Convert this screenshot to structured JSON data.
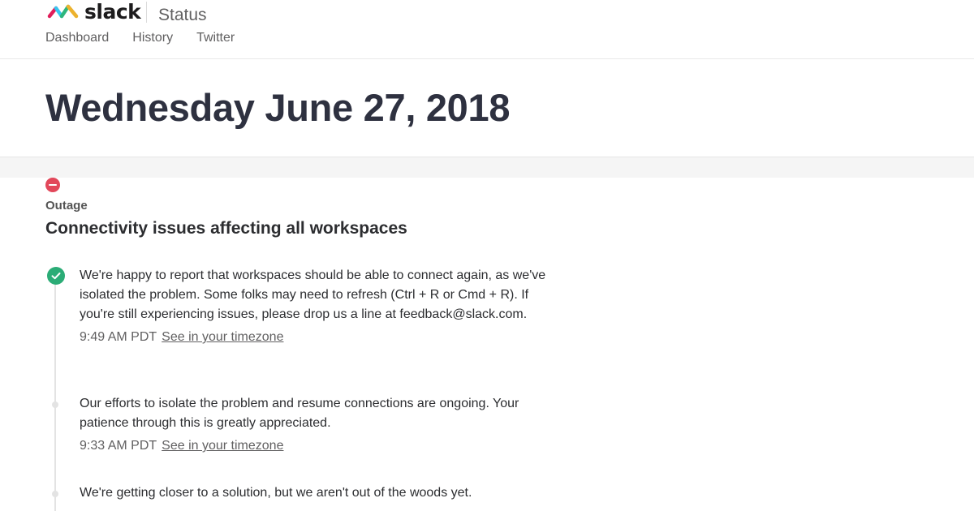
{
  "header": {
    "brand_name": "slack",
    "section_title": "Status",
    "nav": [
      {
        "label": "Dashboard"
      },
      {
        "label": "History"
      },
      {
        "label": "Twitter"
      }
    ]
  },
  "date_title": "Wednesday June 27, 2018",
  "incident": {
    "status_icon": "minus-circle-icon",
    "status_color": "#e2475a",
    "type": "Outage",
    "title": "Connectivity issues affecting all workspaces"
  },
  "updates": [
    {
      "icon": "check-circle-icon",
      "icon_color": "#2bac76",
      "text": "We're happy to report that workspaces should be able to connect again, as we've isolated the problem. Some folks may need to refresh (Ctrl + R or Cmd + R). If you're still experiencing issues, please drop us a line at feedback@slack.com.",
      "time": "9:49 AM PDT",
      "tz_link": "See in your timezone"
    },
    {
      "icon": "timeline-dot",
      "text": "Our efforts to isolate the problem and resume connections are ongoing. Your patience through this is greatly appreciated.",
      "time": "9:33 AM PDT",
      "tz_link": "See in your timezone"
    },
    {
      "icon": "timeline-dot",
      "text": "We're getting closer to a solution, but we aren't out of the woods yet."
    }
  ],
  "colors": {
    "heading": "#2e3140",
    "text": "#2c2d30",
    "muted": "#616061",
    "band": "#f5f5f5"
  }
}
